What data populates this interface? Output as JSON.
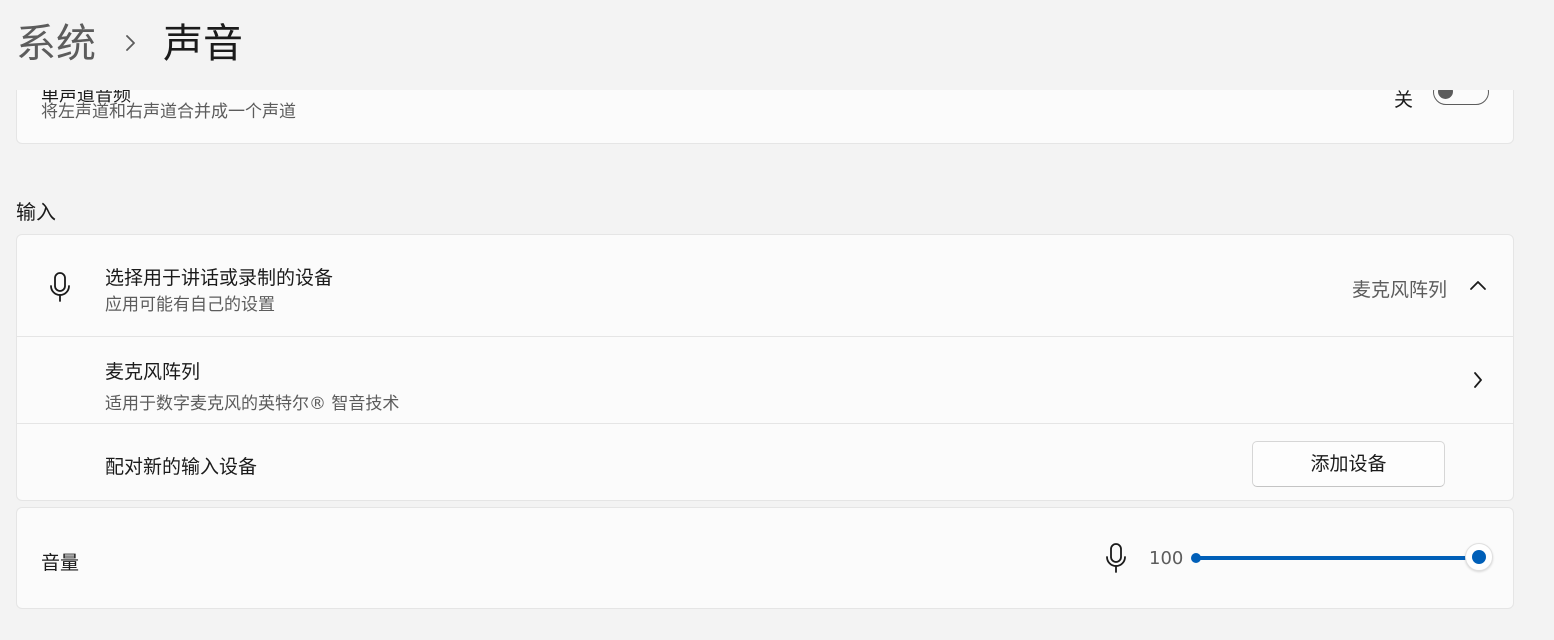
{
  "breadcrumb": {
    "parent": "系统",
    "separator_icon": "chevron-right-icon",
    "current": "声音"
  },
  "mono_audio": {
    "title": "单声道音频",
    "description": "将左声道和右声道合并成一个声道",
    "state_label": "关",
    "toggle_on": false
  },
  "input_section": {
    "title": "输入",
    "device_selector": {
      "icon": "microphone-icon",
      "title": "选择用于讲话或录制的设备",
      "description": "应用可能有自己的设置",
      "selected_value": "麦克风阵列",
      "expand_icon": "chevron-up-icon"
    },
    "devices": [
      {
        "name": "麦克风阵列",
        "description": "适用于数字麦克风的英特尔® 智音技术",
        "nav_icon": "chevron-right-icon"
      }
    ],
    "pair_row": {
      "label": "配对新的输入设备",
      "button_label": "添加设备"
    }
  },
  "volume": {
    "label": "音量",
    "icon": "microphone-icon",
    "value_text": "100",
    "level_percent": 100
  },
  "colors": {
    "accent": "#005fb8",
    "background": "#f3f3f3",
    "card": "#fbfbfb"
  }
}
